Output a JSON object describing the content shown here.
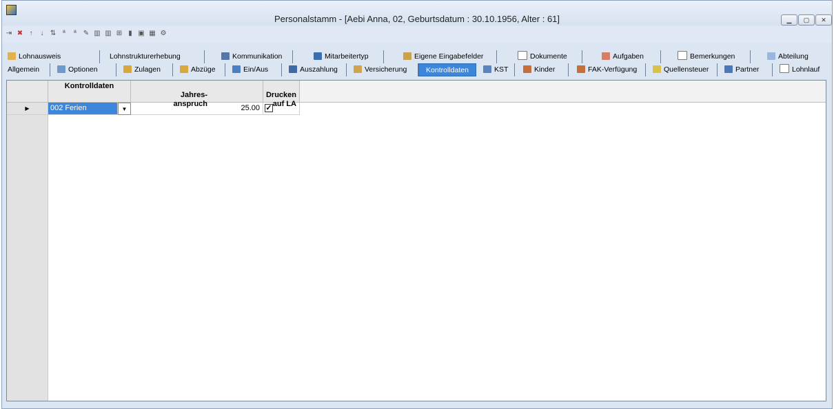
{
  "window": {
    "title": "Personalstamm - [Aebi Anna, 02, Geburtsdatum : 30.10.1956, Alter : 61]"
  },
  "tabs_row1": [
    {
      "label": "Lohnausweis",
      "icon": "pencil-icon"
    },
    {
      "label": "Lohnstrukturerhebung",
      "icon": ""
    },
    {
      "label": "Kommunikation",
      "icon": "phone-icon"
    },
    {
      "label": "Mitarbeitertyp",
      "icon": "people-icon"
    },
    {
      "label": "Eigene Eingabefelder",
      "icon": "edit-icon"
    },
    {
      "label": "Dokumente",
      "icon": "document-icon"
    },
    {
      "label": "Aufgaben",
      "icon": "tasks-icon"
    },
    {
      "label": "Bemerkungen",
      "icon": "note-icon"
    },
    {
      "label": "Abteilung",
      "icon": "department-icon"
    }
  ],
  "tabs_row2": [
    {
      "label": "Allgemein",
      "icon": ""
    },
    {
      "label": "Optionen",
      "icon": "options-icon"
    },
    {
      "label": "Zulagen",
      "icon": "plus-icon"
    },
    {
      "label": "Abzüge",
      "icon": "minus-icon"
    },
    {
      "label": "Ein/Aus",
      "icon": "arrows-icon"
    },
    {
      "label": "Auszahlung",
      "icon": "payment-icon"
    },
    {
      "label": "Versicherung",
      "icon": "insurance-icon"
    },
    {
      "label": "Kontrolldaten",
      "icon": ""
    },
    {
      "label": "KST",
      "icon": "cost-center-icon"
    },
    {
      "label": "Kinder",
      "icon": "children-icon"
    },
    {
      "label": "FAK-Verfügung",
      "icon": "fak-icon"
    },
    {
      "label": "Quellensteuer",
      "icon": "tax-icon"
    },
    {
      "label": "Partner",
      "icon": "partner-icon"
    },
    {
      "label": "Lohnlauf",
      "icon": "payroll-icon"
    }
  ],
  "active_tab": "Kontrolldaten",
  "grid": {
    "columns": [
      {
        "header": "Kontrolldaten"
      },
      {
        "header": "Jahres-\nanspruch"
      },
      {
        "header": "Drucken\nauf LA"
      }
    ],
    "rows": [
      {
        "kontrolldaten": "002 Ferien",
        "jahresanspruch": "25.00",
        "drucken": true
      }
    ]
  },
  "colors": {
    "active_tab": "#3c86dc",
    "selected_cell": "#3c86dc",
    "window_bg": "#dce6f2"
  }
}
